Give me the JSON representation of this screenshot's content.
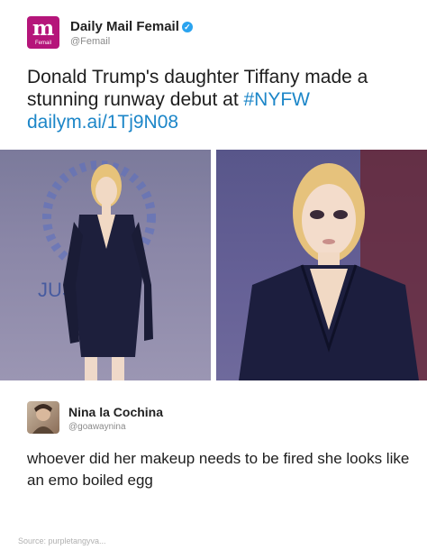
{
  "tweet": {
    "avatar_letter": "m",
    "avatar_tag": "Femail",
    "name": "Daily Mail Femail",
    "verified_mark": "✓",
    "handle": "@Femail",
    "text": "Donald Trump's daughter Tiffany made a stunning runway debut at ",
    "hashtag": "#NYFW",
    "link": "dailym.ai/1Tj9N08"
  },
  "photos": {
    "left_backdrop_text": "JUS"
  },
  "reply": {
    "name": "Nina la Cochina",
    "handle": "@goawaynina",
    "text": "whoever did her makeup needs to be fired she looks like an emo boiled egg"
  },
  "footer": {
    "source": "Source: purpletangyva..."
  },
  "colors": {
    "brand": "#b5157a",
    "link": "#1c86c8",
    "verified": "#2aa3ef"
  },
  "icons": [
    "verified-icon"
  ]
}
